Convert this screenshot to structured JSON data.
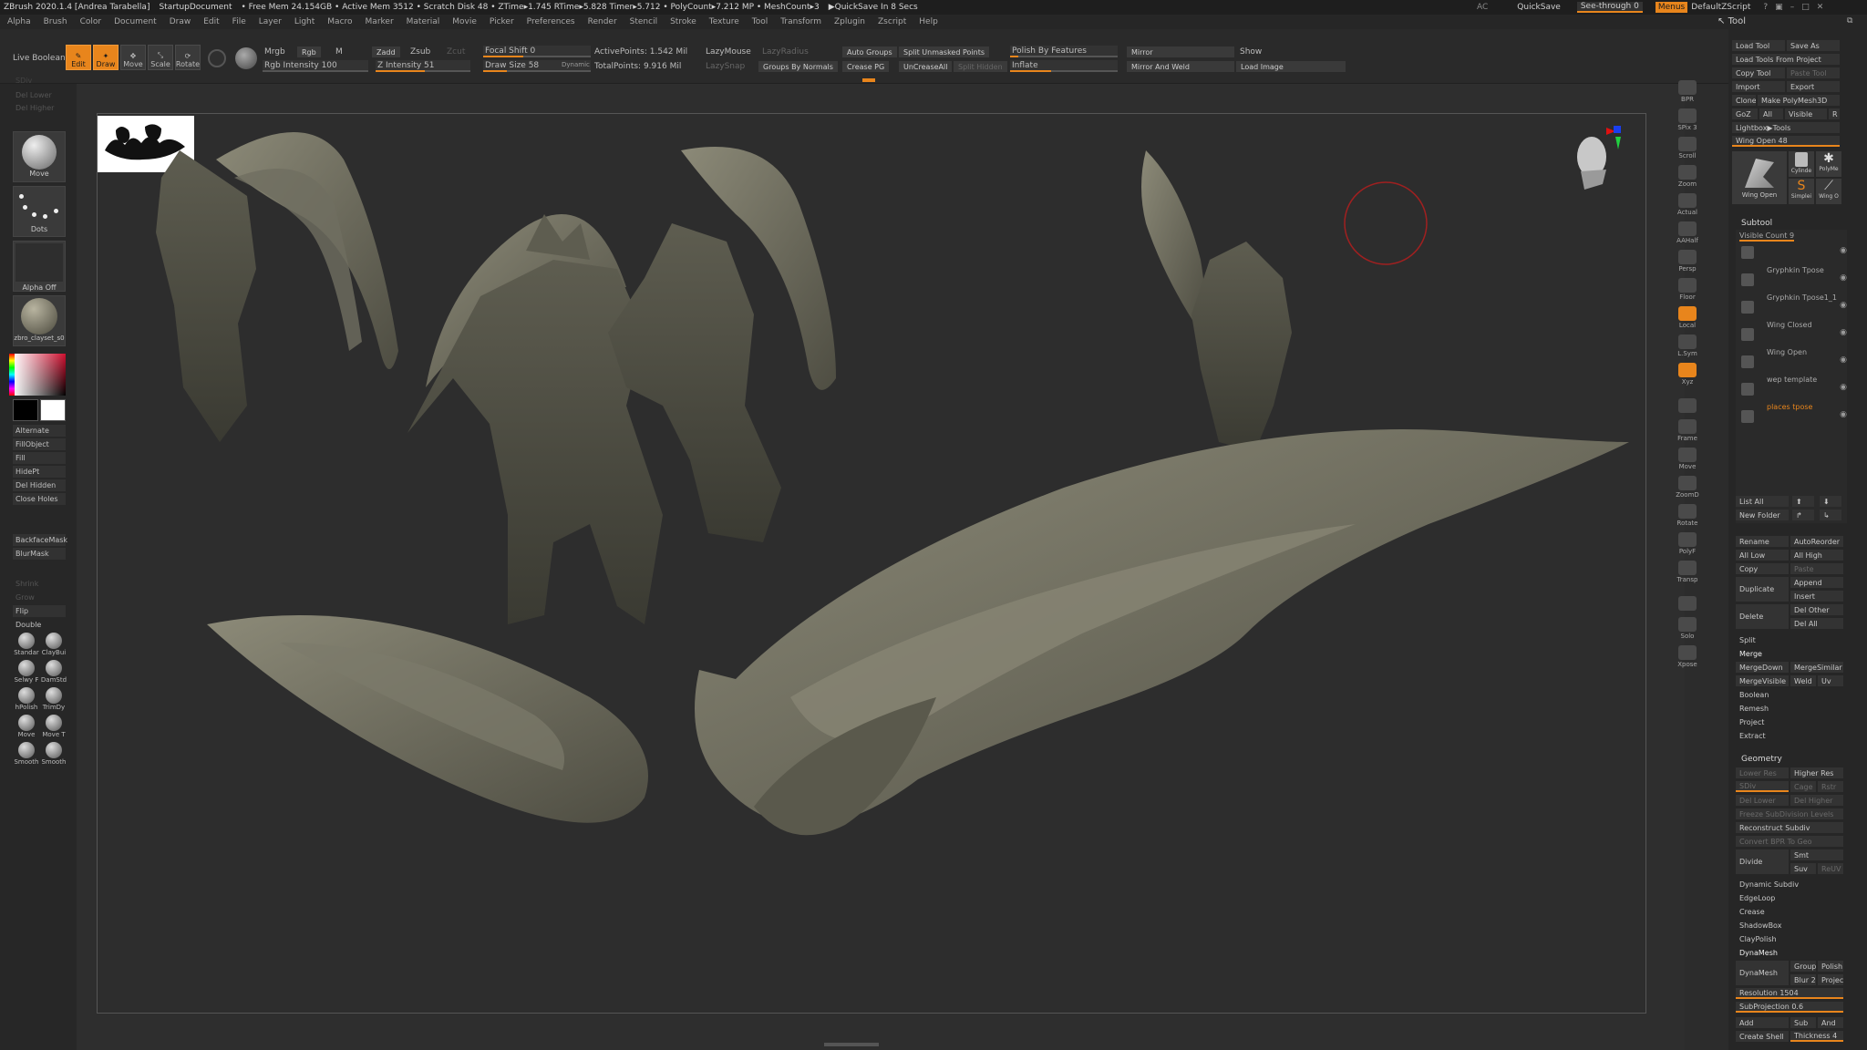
{
  "titlebar": {
    "app": "ZBrush 2020.1.4 [Andrea Tarabella]",
    "document": "StartupDocument",
    "stats": "• Free Mem 24.154GB • Active Mem 3512 • Scratch Disk 48 • ZTime▸1.745 RTime▸5.828 Timer▸5.712 • PolyCount▸7.212 MP • MeshCount▸3",
    "quicksave": "▶QuickSave In 8 Secs",
    "ac": "AC",
    "quicksave_btn": "QuickSave",
    "seethrough": "See-through  0",
    "menus": "Menus",
    "script": "DefaultZScript"
  },
  "menubar": [
    "Alpha",
    "Brush",
    "Color",
    "Document",
    "Draw",
    "Edit",
    "File",
    "Layer",
    "Light",
    "Macro",
    "Marker",
    "Material",
    "Movie",
    "Picker",
    "Preferences",
    "Render",
    "Stencil",
    "Stroke",
    "Texture",
    "Tool",
    "Transform",
    "Zplugin",
    "Zscript",
    "Help"
  ],
  "shelf": {
    "live_boolean": "Live Boolean",
    "edit": "Edit",
    "draw": "Draw",
    "move": "Move",
    "scale": "Scale",
    "rotate": "Rotate",
    "mrgb": "Mrgb",
    "rgb": "Rgb",
    "m": "M",
    "rgb_intensity": "Rgb Intensity 100",
    "zadd": "Zadd",
    "zsub": "Zsub",
    "zcut": "Zcut",
    "z_intensity": "Z Intensity 51",
    "focal_shift": "Focal Shift 0",
    "draw_size": "Draw Size 58",
    "dynamic": "Dynamic",
    "active_points": "ActivePoints: 1.542 Mil",
    "total_points": "TotalPoints: 9.916 Mil",
    "lazymouse": "LazyMouse",
    "lazyradius": "LazyRadius",
    "lazysnap": "LazySnap",
    "auto_groups": "Auto Groups",
    "split_unmasked": "Split Unmasked Points",
    "groups_by_normals": "Groups By Normals",
    "crease_pg": "Crease PG",
    "uncreaseall": "UnCreaseAll",
    "split_hidden": "Split Hidden",
    "polish_by_features": "Polish By Features",
    "inflate": "Inflate",
    "mirror": "Mirror",
    "mirror_and_weld": "Mirror And Weld",
    "show": "Show",
    "load_image": "Load Image"
  },
  "leftpanel": {
    "sdiv": "SDiv",
    "del_lower": "Del Lower",
    "del_higher": "Del Higher",
    "brush": "Move",
    "stroke": "Dots",
    "alpha": "Alpha Off",
    "material": "zbro_clayset_s0",
    "buttons": [
      "Alternate",
      "FillObject",
      "Fill",
      "HidePt",
      "Del Hidden",
      "Close Holes",
      "BackfaceMask",
      "BlurMask",
      "Shrink",
      "Grow",
      "Flip",
      "Double"
    ],
    "brushes": [
      "Standar",
      "ClayBui",
      "Selwy F",
      "DamStd",
      "hPolish",
      "TrimDy",
      "Move",
      "Move T",
      "Smooth",
      "Smooth"
    ]
  },
  "vtoolbar": [
    "BPR",
    "SPix 3",
    "Scroll",
    "Zoom",
    "Actual",
    "AAHalf",
    "Persp",
    "Floor",
    "Local",
    "L.Sym",
    "Xyz",
    "",
    "Frame",
    "Move",
    "ZoomD",
    "Rotate",
    "PolyF",
    "Transp",
    "",
    "Solo",
    "Xpose"
  ],
  "rightpanel": {
    "tool_title": "Tool",
    "load_tool": "Load Tool",
    "save_as": "Save As",
    "load_tools_from_project": "Load Tools From Project",
    "copy_tool": "Copy Tool",
    "paste_tool": "Paste Tool",
    "import": "Import",
    "export": "Export",
    "clone": "Clone",
    "make_polymesh": "Make PolyMesh3D",
    "goz": "GoZ",
    "all": "All",
    "visible": "Visible",
    "r": "R",
    "lightbox_tools": "Lightbox▶Tools",
    "wing_open_slider": "Wing Open  48",
    "tool_thumbs": [
      "Wing Open",
      "Cylinde",
      "PolyMe",
      "Simplei",
      "Wing O"
    ],
    "subtool_head": "Subtool",
    "visible_count": "Visible Count 9",
    "subtools": [
      "",
      "Gryphkin Tpose",
      "Gryphkin Tpose1_1",
      "Wing Closed",
      "Wing Open",
      "wep template",
      "places tpose"
    ],
    "list_all": "List All",
    "new_folder": "New Folder",
    "rename": "Rename",
    "autoreorder": "AutoReorder",
    "all_low": "All Low",
    "all_high": "All High",
    "copy": "Copy",
    "paste": "Paste",
    "duplicate": "Duplicate",
    "append": "Append",
    "insert": "Insert",
    "delete": "Delete",
    "del_other": "Del Other",
    "del_all": "Del All",
    "split": "Split",
    "merge": "Merge",
    "mergedown": "MergeDown",
    "mergesimilar": "MergeSimilar",
    "mergevisible": "MergeVisible",
    "weld": "Weld",
    "uv": "Uv",
    "boolean": "Boolean",
    "remesh": "Remesh",
    "project": "Project",
    "extract": "Extract",
    "geometry_head": "Geometry",
    "lower_res": "Lower Res",
    "higher_res": "Higher Res",
    "sdiv": "SDiv",
    "cage": "Cage",
    "rstr": "Rstr",
    "del_lower": "Del Lower",
    "del_higher": "Del Higher",
    "freeze_subdiv": "Freeze SubDivision Levels",
    "reconstruct_subdiv": "Reconstruct Subdiv",
    "convert_bpr": "Convert BPR To Geo",
    "divide": "Divide",
    "smt": "Smt",
    "suv": "Suv",
    "reuv": "ReUV",
    "dynamic_subdiv": "Dynamic Subdiv",
    "edgeloop": "EdgeLoop",
    "crease": "Crease",
    "shadowbox": "ShadowBox",
    "claypolish": "ClayPolish",
    "dynamesh_head": "DynaMesh",
    "dynamesh": "DynaMesh",
    "group": "Group",
    "polish": "Polish",
    "blur": "Blur 2",
    "project2": "Project",
    "resolution": "Resolution 1504",
    "subprojection": "SubProjection 0.6",
    "add": "Add",
    "sub": "Sub",
    "and": "And",
    "create_shell": "Create Shell",
    "thickness": "Thickness 4"
  },
  "colors": {
    "accent": "#e8851c",
    "background": "#2c2c2c",
    "model": "#6f6e60"
  }
}
